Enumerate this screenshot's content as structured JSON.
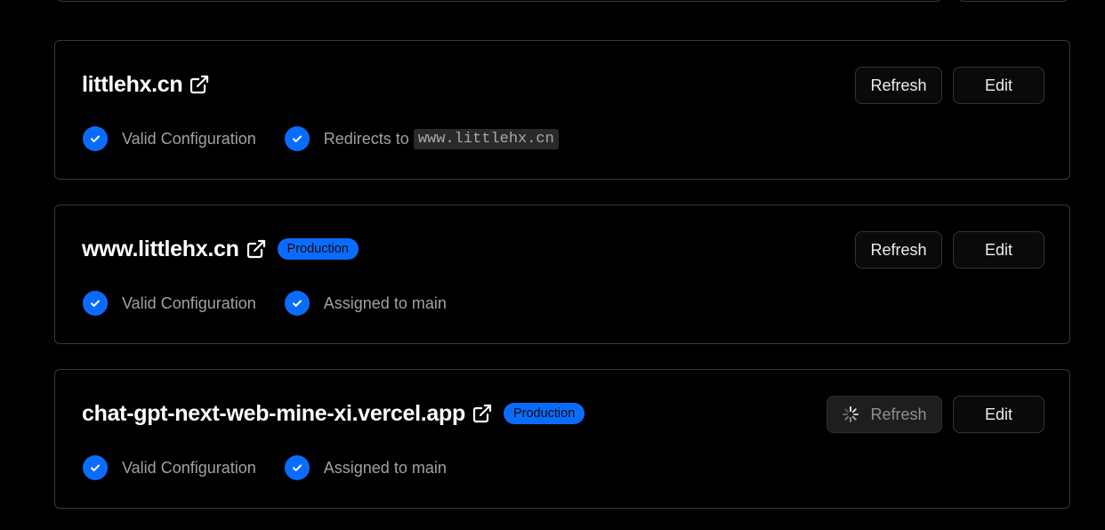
{
  "domains": [
    {
      "name": "littlehx.cn",
      "badge": "",
      "status_1": "Valid Configuration",
      "status_2_prefix": "Redirects to",
      "status_2_code": "www.littlehx.cn",
      "refresh_label": "Refresh",
      "edit_label": "Edit"
    },
    {
      "name": "www.littlehx.cn",
      "badge": "Production",
      "status_1": "Valid Configuration",
      "status_2": "Assigned to main",
      "refresh_label": "Refresh",
      "edit_label": "Edit"
    },
    {
      "name": "chat-gpt-next-web-mine-xi.vercel.app",
      "badge": "Production",
      "status_1": "Valid Configuration",
      "status_2": "Assigned to main",
      "refresh_label": "Refresh",
      "refresh_loading": true,
      "edit_label": "Edit"
    }
  ],
  "icons": {
    "external_link": "external-link-icon",
    "check": "check-circle-icon",
    "spinner": "spinner-icon"
  },
  "colors": {
    "background": "#000000",
    "accent": "#0a6cff",
    "card_border": "#383838",
    "muted_text": "#a1a1a1"
  }
}
